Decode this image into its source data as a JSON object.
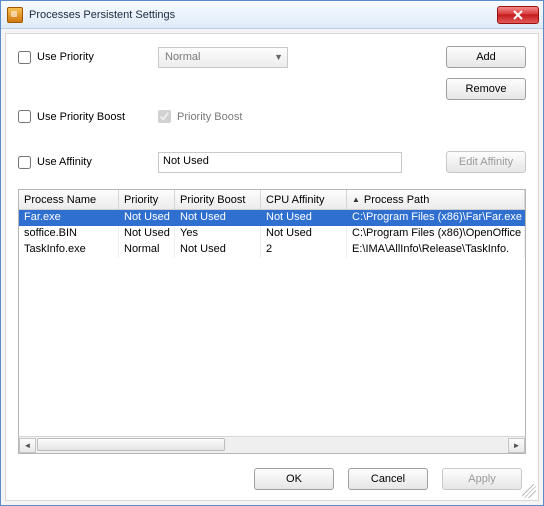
{
  "window": {
    "title": "Processes Persistent Settings"
  },
  "form": {
    "usePriority": {
      "label": "Use Priority",
      "checked": false
    },
    "priorityCombo": {
      "value": "Normal"
    },
    "addBtn": "Add",
    "removeBtn": "Remove",
    "usePriorityBoost": {
      "label": "Use Priority Boost",
      "checked": false
    },
    "priorityBoostChk": {
      "label": "Priority Boost",
      "checked": true
    },
    "useAffinity": {
      "label": "Use Affinity",
      "checked": false
    },
    "affinityText": "Not Used",
    "editAffinityBtn": "Edit Affinity"
  },
  "table": {
    "headers": [
      "Process Name",
      "Priority",
      "Priority Boost",
      "CPU Affinity",
      "Process Path"
    ],
    "sortCol": 4,
    "rows": [
      {
        "sel": true,
        "cells": [
          "Far.exe",
          "Not Used",
          "Not Used",
          "Not Used",
          "C:\\Program Files (x86)\\Far\\Far.exe"
        ]
      },
      {
        "sel": false,
        "cells": [
          " soffice.BIN",
          "Not Used",
          "Yes",
          "Not Used",
          "C:\\Program Files (x86)\\OpenOffice"
        ]
      },
      {
        "sel": false,
        "cells": [
          " TaskInfo.exe",
          "Normal",
          "Not Used",
          "2",
          "E:\\IMA\\AllInfo\\Release\\TaskInfo."
        ]
      }
    ]
  },
  "footer": {
    "ok": "OK",
    "cancel": "Cancel",
    "apply": "Apply"
  }
}
